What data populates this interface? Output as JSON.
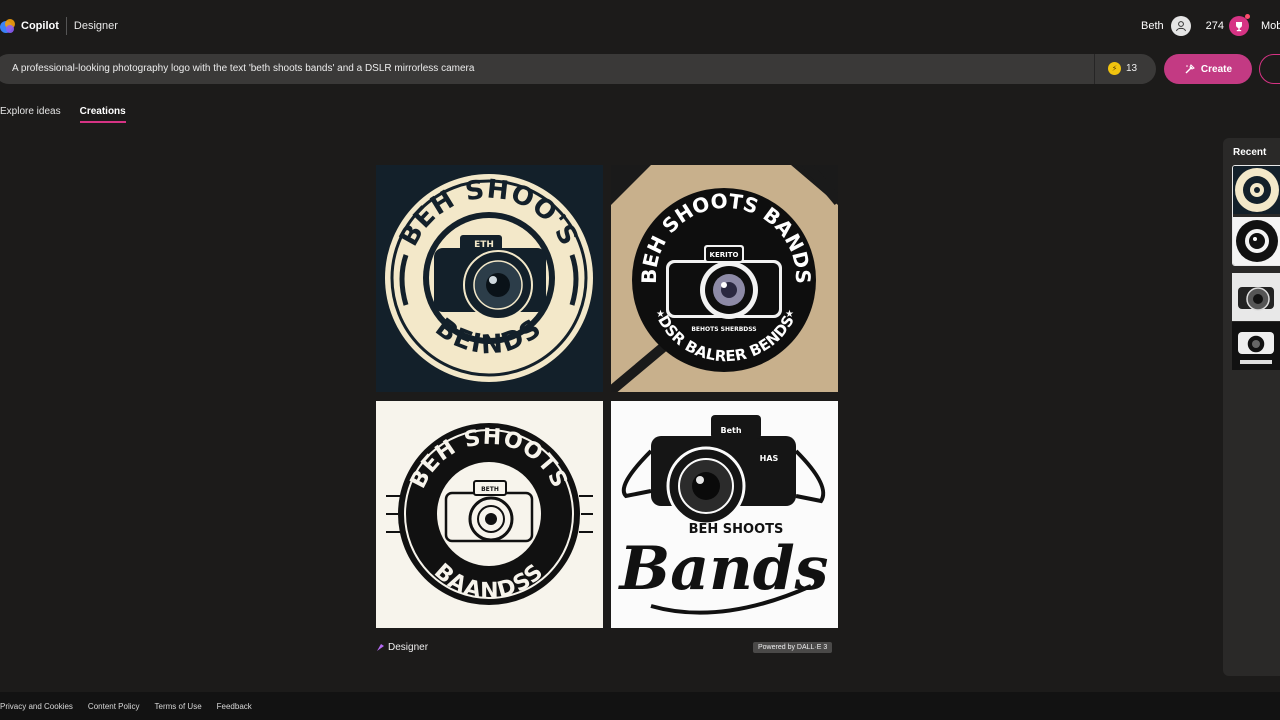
{
  "header": {
    "brand": "Copilot",
    "product": "Designer",
    "user_name": "Beth",
    "points": "274",
    "mobile_label": "Mobile",
    "icons": [
      "copilot-logo-icon",
      "user-avatar-icon",
      "rewards-trophy-icon"
    ]
  },
  "prompt": {
    "text": "A professional-looking photography logo with the text 'beth shoots bands' and a DSLR mirrorless camera",
    "boosts": "13",
    "create_label": "Create"
  },
  "tabs": [
    {
      "label": "Explore ideas",
      "active": false
    },
    {
      "label": "Creations",
      "active": true
    }
  ],
  "images": [
    {
      "top_text": "BEH SHOO'S",
      "bottom_text": "BEINDS",
      "camera_label": "ETH"
    },
    {
      "top_text": "BEH SHOOTS BANDS",
      "bottom_text": "DSR BALRER BENDS",
      "camera_label": "KERITO",
      "ribbon_text": "BEHOTS SHERBDSS"
    },
    {
      "top_text": "BEH SHOOTS",
      "bottom_text": "BAANDSS",
      "camera_label": "BETH"
    },
    {
      "small_text": "BEH SHOOTS",
      "script_text": "Bands",
      "camera_label": "Beth",
      "side_label": "HAS"
    }
  ],
  "attribution": {
    "designer_label": "Designer",
    "powered_by": "Powered by DALL·E 3"
  },
  "recent": {
    "title": "Recent"
  },
  "footer": {
    "links": [
      "Privacy and Cookies",
      "Content Policy",
      "Terms of Use",
      "Feedback"
    ]
  },
  "colors": {
    "background": "#1c1b1a",
    "accent": "#c33a83",
    "prompt_bar": "#3a3938",
    "cream": "#f3e8c9",
    "tan": "#c8b08c"
  }
}
